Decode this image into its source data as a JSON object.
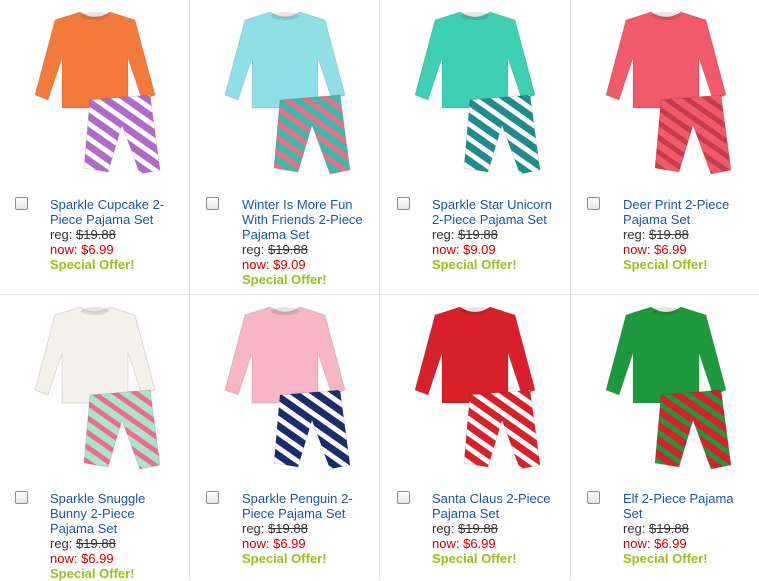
{
  "labels": {
    "reg": "reg:",
    "now": "now:",
    "special_offer": "Special Offer!"
  },
  "products": [
    {
      "name": "Sparkle Cupcake 2-Piece Pajama Set",
      "name_lines": [
        "Sparkle Cupcake 2-",
        "Piece Pajama Set"
      ],
      "reg_price": "$19.88",
      "now_price": "$6.99",
      "offer": "Special Offer!",
      "image": "cupcake-pajama-image",
      "colors": {
        "top": "#f47a3c",
        "pants": "#b06ac8",
        "stripe": "#ffffff"
      }
    },
    {
      "name": "Winter Is More Fun With Friends 2-Piece Pajama Set",
      "name_lines": [
        "Winter Is More Fun",
        "With Friends 2-Piece",
        "Pajama Set"
      ],
      "reg_price": "$19.88",
      "now_price": "$9.09",
      "offer": "Special Offer!",
      "image": "winter-friends-pajama-image",
      "colors": {
        "top": "#8fe0e6",
        "pants": "#3fb8a8",
        "stripe": "#f06a8a"
      }
    },
    {
      "name": "Sparkle Star Unicorn 2-Piece Pajama Set",
      "name_lines": [
        "Sparkle Star Unicorn",
        "2-Piece Pajama Set"
      ],
      "reg_price": "$19.88",
      "now_price": "$9.09",
      "offer": "Special Offer!",
      "image": "star-unicorn-pajama-image",
      "colors": {
        "top": "#3fcfb2",
        "pants": "#1e8c8a",
        "stripe": "#ffffff"
      }
    },
    {
      "name": "Deer Print 2-Piece Pajama Set",
      "name_lines": [
        "Deer Print 2-Piece",
        "Pajama Set"
      ],
      "reg_price": "$19.88",
      "now_price": "$6.99",
      "offer": "Special Offer!",
      "image": "deer-print-pajama-image",
      "colors": {
        "top": "#f05a6a",
        "pants": "#f05a6a",
        "stripe": "#c93a4a"
      }
    },
    {
      "name": "Sparkle Snuggle Bunny 2-Piece Pajama Set",
      "name_lines": [
        "Sparkle Snuggle",
        "Bunny 2-Piece",
        "Pajama Set"
      ],
      "reg_price": "$19.88",
      "now_price": "$6.99",
      "offer": "Special Offer!",
      "image": "snuggle-bunny-pajama-image",
      "colors": {
        "top": "#f4f0ea",
        "pants": "#a8e6cc",
        "stripe": "#f06a8a"
      }
    },
    {
      "name": "Sparkle Penguin 2-Piece Pajama Set",
      "name_lines": [
        "Sparkle Penguin 2-",
        "Piece Pajama Set"
      ],
      "reg_price": "$19.88",
      "now_price": "$6.99",
      "offer": "Special Offer!",
      "image": "penguin-pajama-image",
      "colors": {
        "top": "#f7b6c6",
        "pants": "#1c2d6e",
        "stripe": "#ffffff"
      }
    },
    {
      "name": "Santa Claus 2-Piece Pajama Set",
      "name_lines": [
        "Santa Claus 2-Piece",
        "Pajama Set"
      ],
      "reg_price": "$19.88",
      "now_price": "$6.99",
      "offer": "Special Offer!",
      "image": "santa-claus-pajama-image",
      "colors": {
        "top": "#d8202a",
        "pants": "#d8202a",
        "stripe": "#ffffff"
      }
    },
    {
      "name": "Elf 2-Piece Pajama Set",
      "name_lines": [
        "Elf 2-Piece Pajama",
        "Set"
      ],
      "reg_price": "$19.88",
      "now_price": "$6.99",
      "offer": "Special Offer!",
      "image": "elf-pajama-image",
      "colors": {
        "top": "#1e9a3e",
        "pants": "#d8202a",
        "stripe": "#1e9a3e"
      }
    }
  ]
}
